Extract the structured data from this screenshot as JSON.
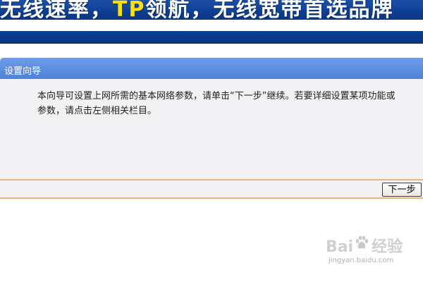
{
  "banner": {
    "slogan_part1": "无线速率，",
    "slogan_highlight": "TP",
    "slogan_part2": "领航，无线宽带首选品牌"
  },
  "wizard": {
    "title": "设置向导",
    "description": "本向导可设置上网所需的基本网络参数，请单击“下一步”继续。若要详细设置某项功能或参数，请点击左侧相关栏目。",
    "next_label": "下一步"
  },
  "watermark": {
    "brand_left": "Bai",
    "brand_right": "经验",
    "url": "jingyan.baidu.com"
  },
  "colors": {
    "banner_blue": "#0a3480",
    "titlebar_blue": "#5b8ee0",
    "panel_bg": "#f2f1f3",
    "separator_orange": "#e9b77a"
  }
}
